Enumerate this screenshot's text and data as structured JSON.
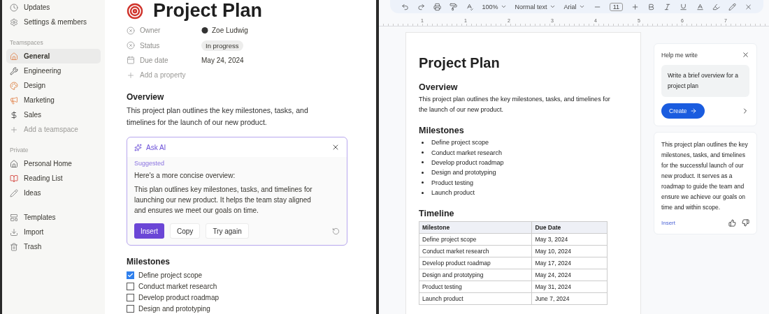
{
  "sidebar": {
    "top_items": [
      {
        "label": "Updates"
      },
      {
        "label": "Settings & members"
      }
    ],
    "sections": [
      {
        "title": "Teamspaces",
        "items": [
          {
            "label": "General",
            "selected": true
          },
          {
            "label": "Engineering",
            "selected": false
          },
          {
            "label": "Design",
            "selected": false
          },
          {
            "label": "Marketing",
            "selected": false
          },
          {
            "label": "Sales",
            "selected": false
          }
        ],
        "add_label": "Add a teamspace"
      },
      {
        "title": "Private",
        "items": [
          {
            "label": "Personal Home",
            "selected": false
          },
          {
            "label": "Reading List",
            "selected": false
          },
          {
            "label": "Ideas",
            "selected": false
          }
        ]
      }
    ],
    "bottom_items": [
      {
        "label": "Templates"
      },
      {
        "label": "Import"
      },
      {
        "label": "Trash"
      }
    ]
  },
  "notion_page": {
    "title": "Project Plan",
    "properties": [
      {
        "kind": "person",
        "name": "Owner",
        "value": "Zoe Ludwig"
      },
      {
        "kind": "status",
        "name": "Status",
        "value": "In progress"
      },
      {
        "kind": "date",
        "name": "Due date",
        "value": "May 24, 2024"
      }
    ],
    "add_property": "Add a property",
    "overview_heading": "Overview",
    "overview_text": "This project plan outlines the key milestones, tasks, and timelines for the launch of our new product.",
    "ask_ai": {
      "title": "Ask AI",
      "label": "Suggested",
      "intro": "Here's a more concise overview:",
      "suggestion": "This plan outlines key milestones, tasks, and timelines for launching our new product. It helps the team stay aligned and ensures we meet our goals on time.",
      "buttons": [
        {
          "label": "Insert",
          "primary": true
        },
        {
          "label": "Copy",
          "primary": false
        },
        {
          "label": "Try again",
          "primary": false
        }
      ]
    },
    "milestones_heading": "Milestones",
    "milestones": [
      {
        "label": "Define project scope",
        "checked": true
      },
      {
        "label": "Conduct market research",
        "checked": false
      },
      {
        "label": "Develop product roadmap",
        "checked": false
      },
      {
        "label": "Design and prototyping",
        "checked": false
      }
    ]
  },
  "docs": {
    "toolbar": {
      "zoom": "100%",
      "style": "Normal text",
      "font": "Arial",
      "size": "11"
    },
    "ruler_labels": [
      "1",
      "1",
      "2",
      "3",
      "4",
      "5",
      "6",
      "7"
    ],
    "document": {
      "title": "Project Plan",
      "overview_heading": "Overview",
      "overview_text": "This project plan outlines the key milestones, tasks, and timelines for the launch of our new product.",
      "milestones_heading": "Milestones",
      "milestones": [
        "Define project scope",
        "Conduct market research",
        "Develop product roadmap",
        "Design and prototyping",
        "Product testing",
        "Launch product"
      ],
      "timeline_heading": "Timeline",
      "table": {
        "columns": [
          "Milestone",
          "Due Date"
        ],
        "rows": [
          [
            "Define project scope",
            "May 3, 2024"
          ],
          [
            "Conduct market research",
            "May 10, 2024"
          ],
          [
            "Develop product roadmap",
            "May 17, 2024"
          ],
          [
            "Design and prototyping",
            "May 24, 2024"
          ],
          [
            "Product testing",
            "May 31, 2024"
          ],
          [
            "Launch product",
            "June 7, 2024"
          ]
        ]
      }
    },
    "help_panel": {
      "title": "Help me write",
      "prompt": "Write a brief overview for a project plan",
      "create_label": "Create",
      "result": "This project plan outlines the key milestones, tasks, and timelines for the successful launch of our new product. It serves as a roadmap to guide the team and ensure we achieve our goals on time and within scope.",
      "insert_label": "Insert"
    }
  }
}
